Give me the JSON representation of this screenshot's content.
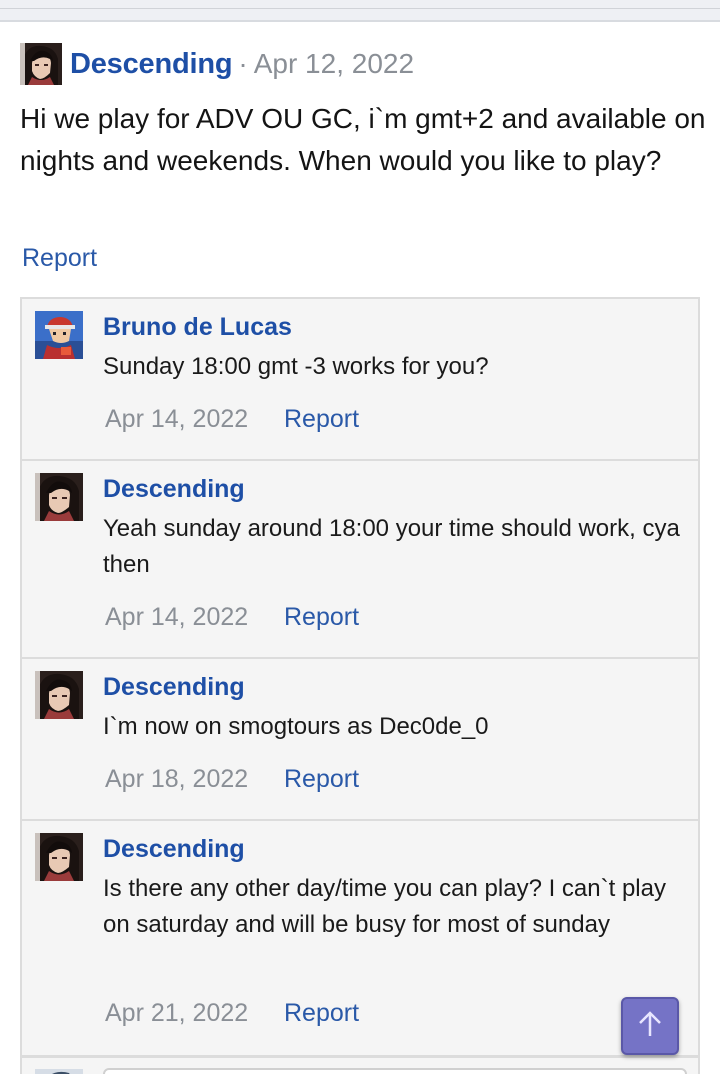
{
  "post": {
    "author": "Descending",
    "separator": "·",
    "date": "Apr 12, 2022",
    "body": "Hi we play for ADV OU GC, i`m gmt+2 and available on nights and weekends. When would you like to play?",
    "report_label": "Report"
  },
  "comments": [
    {
      "author": "Bruno de Lucas",
      "avatar": "trainer-avatar",
      "text": "Sunday 18:00 gmt -3 works for you?",
      "date": "Apr 14, 2022",
      "report_label": "Report"
    },
    {
      "author": "Descending",
      "avatar": "dark-haired-girl-avatar",
      "text": "Yeah sunday around 18:00 your time should work, cya then",
      "date": "Apr 14, 2022",
      "report_label": "Report"
    },
    {
      "author": "Descending",
      "avatar": "dark-haired-girl-avatar",
      "text": "I`m now on smogtours as Dec0de_0",
      "date": "Apr 18, 2022",
      "report_label": "Report"
    },
    {
      "author": "Descending",
      "avatar": "dark-haired-girl-avatar",
      "text": "Is there any other day/time you can play? I can`t play on saturday and will be busy for most of sunday",
      "date": "Apr 21, 2022",
      "report_label": "Report"
    }
  ],
  "scroll_to_top": {
    "icon": "arrow-up-icon"
  },
  "colors": {
    "link": "#1e4fa6",
    "muted": "#8a8f96",
    "comment_bg": "#f5f5f5",
    "scroll_button": "#7573c6"
  }
}
